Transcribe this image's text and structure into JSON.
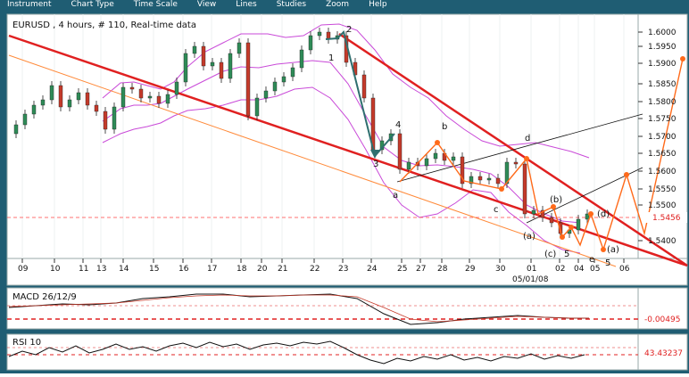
{
  "menu": [
    "Instrument",
    "Chart Type",
    "Time Scale",
    "View",
    "Lines",
    "Studies",
    "Zoom",
    "Help"
  ],
  "colors": {
    "frame_bg": "#1f5d73",
    "plot_bg": "#ffffff",
    "bull_candle": "#2e8b57",
    "bear_candle": "#c43a2a",
    "trend_main": "#e02020",
    "trend_thin": "#ff8a3a",
    "bollinger": "#c94ad8",
    "wave_arrows": "#ff6a1a",
    "wave_count": "#2f6f6f",
    "reference_line": "#ff4444"
  },
  "price_panel": {
    "title": "EURUSD , 4 hours, # 110, Real-time data",
    "y_axis": [
      "1.6000",
      "1.5950",
      "1.5900",
      "1.5850",
      "1.5800",
      "1.5750",
      "1.5700",
      "1.5650",
      "1.5600",
      "1.5550",
      "1.5500",
      "1.5400"
    ],
    "last_price": "1.5456",
    "x_axis": [
      "09",
      "10",
      "11",
      "13",
      "14",
      "15",
      "16",
      "17",
      "18",
      "20",
      "21",
      "22",
      "23",
      "24",
      "25",
      "27",
      "28",
      "29",
      "30",
      "01",
      "02",
      "04",
      "05",
      "06"
    ],
    "date_label": "05/01/08",
    "wave_labels": [
      "1",
      "2",
      "3",
      "4",
      "b",
      "d",
      "c",
      "e",
      "(a)",
      "(b)",
      "(c)",
      "(d)",
      "(e)",
      "(a)",
      "5",
      "5",
      "a"
    ]
  },
  "macd_panel": {
    "label": "MACD 26/12/9",
    "value": "-0.00495"
  },
  "rsi_panel": {
    "label": "RSI 10",
    "value": "43.43237"
  }
}
